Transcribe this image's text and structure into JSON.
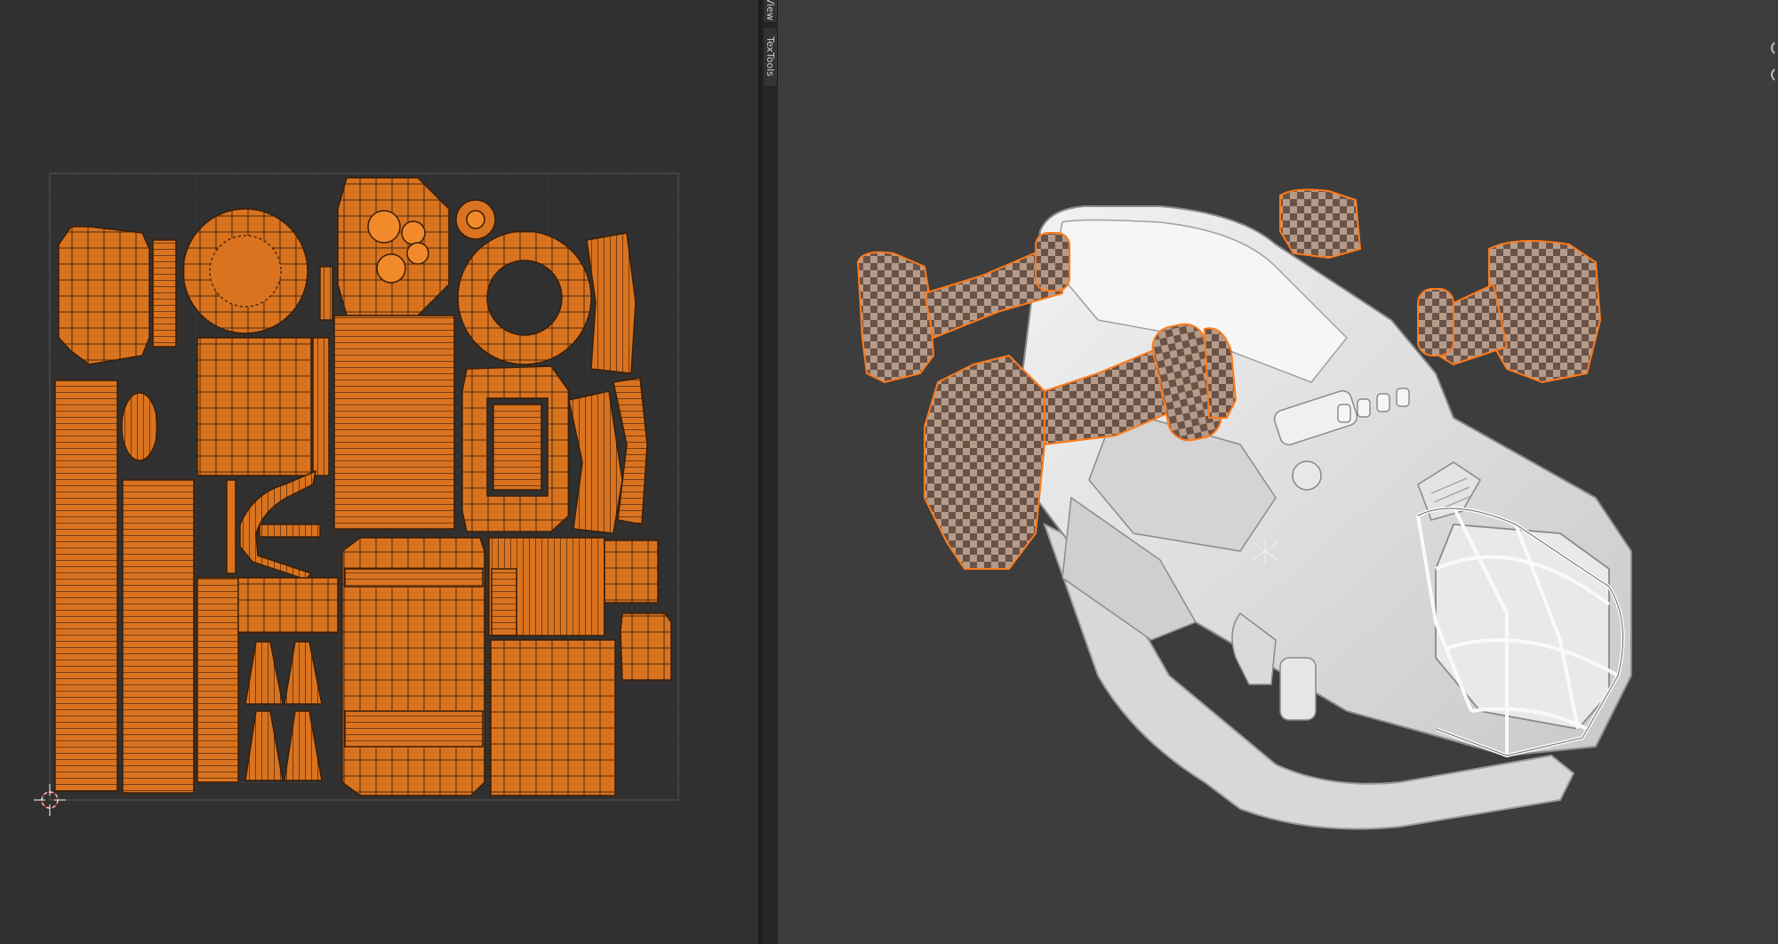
{
  "sidebar": {
    "tabs": [
      {
        "label": "View"
      },
      {
        "label": "TexTools"
      }
    ]
  },
  "colors": {
    "uv_background": "#303030",
    "uv_island": "#d9731f",
    "uv_edge": "#4a2810",
    "vertex": "#f08a2a",
    "viewport_background": "#3d3d3d",
    "model_body": "#e6e6e6",
    "selection_outline": "#ff7a1a",
    "checker_dark": "#6b5247",
    "checker_light": "#b59c8a"
  },
  "icons": {
    "cursor": "2d-cursor-icon",
    "scroll": "viewport-nav-icon"
  }
}
